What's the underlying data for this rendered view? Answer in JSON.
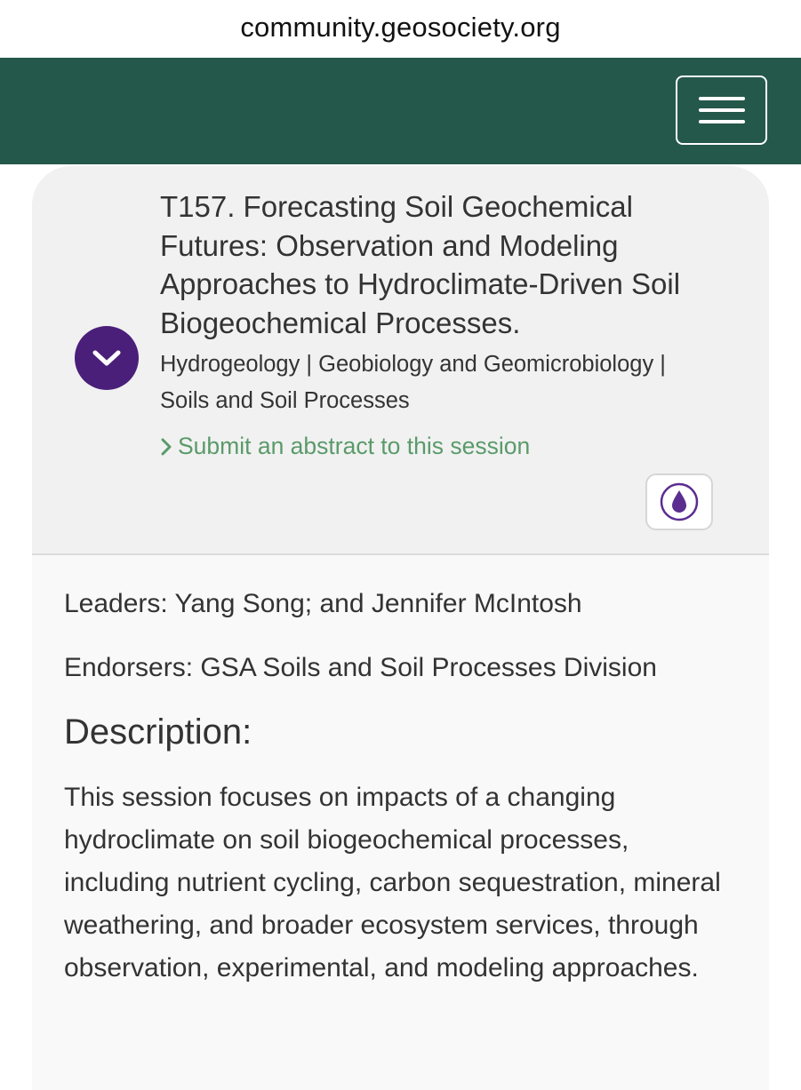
{
  "browser": {
    "url": "community.geosociety.org"
  },
  "session": {
    "title": "T157. Forecasting Soil Geochemical Futures: Observation and Modeling Approaches to Hydroclimate-Driven Soil Biogeochemical Processes.",
    "tags": "Hydrogeology | Geobiology and Geomicrobiology | Soils and Soil Processes",
    "submit_link": "Submit an abstract to this session",
    "badge_icon": "water-drop-icon",
    "leaders": "Leaders: Yang Song; and Jennifer McIntosh",
    "endorsers": "Endorsers: GSA Soils and Soil Processes Division",
    "description_heading": "Description:",
    "description": "This session focuses on impacts of a changing hydroclimate on soil biogeochemical processes, including nutrient cycling, carbon sequestration, mineral weathering, and broader ecosystem services, through observation, experimental, and modeling approaches."
  },
  "colors": {
    "nav_background": "#24584b",
    "toggle_background": "#4a1f7a",
    "link_color": "#5a9a6a",
    "badge_icon_color": "#5b2d91"
  }
}
